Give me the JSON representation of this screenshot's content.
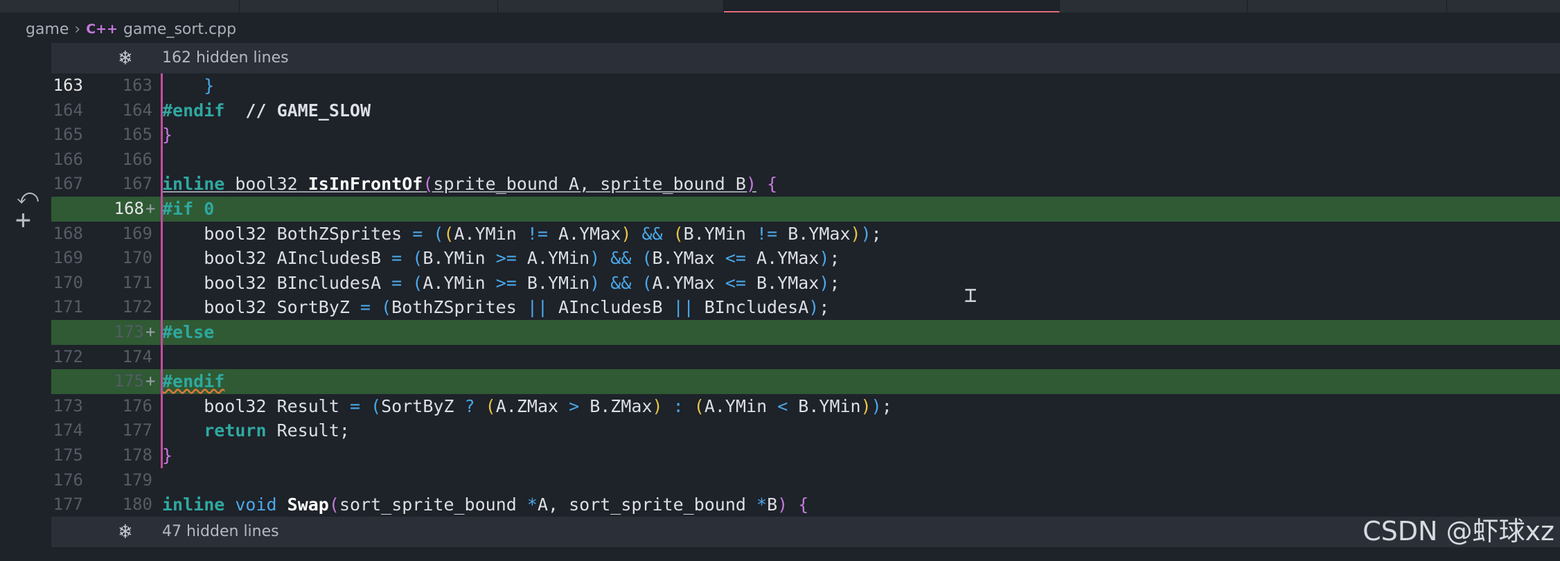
{
  "breadcrumb": {
    "folder": "game",
    "lang_badge": "C++",
    "file": "game_sort.cpp"
  },
  "folds": {
    "top": {
      "label": "162 hidden lines"
    },
    "bottom": {
      "label": "47 hidden lines"
    }
  },
  "lines": [
    {
      "old": "163",
      "new": "163",
      "current": true,
      "added": false,
      "html": "    <span class=\"p3\">}</span>"
    },
    {
      "old": "164",
      "new": "164",
      "current": false,
      "added": false,
      "html": "<span class=\"pp\">#endif</span>  <span class=\"cm\">// GAME_SLOW</span>"
    },
    {
      "old": "165",
      "new": "165",
      "current": false,
      "added": false,
      "html": "<span class=\"p2\">}</span>"
    },
    {
      "old": "166",
      "new": "166",
      "current": false,
      "added": false,
      "html": ""
    },
    {
      "old": "167",
      "new": "167",
      "current": false,
      "added": false,
      "html": "<span class=\"ul\"><span class=\"kw\">inline</span> <span class=\"ty\">bool32</span> <span class=\"fn\">IsInFrontOf</span><span class=\"p2\">(</span>sprite_bound A, sprite_bound B<span class=\"p2\">)</span></span> <span class=\"p2\">{</span>"
    },
    {
      "old": "",
      "new": "168",
      "current": true,
      "added": true,
      "html": "<span class=\"pp\">#if</span> <span class=\"nm\">0</span>"
    },
    {
      "old": "168",
      "new": "169",
      "current": false,
      "added": false,
      "html": "    bool32 BothZSprites <span class=\"op\">=</span> <span class=\"p3\">(</span><span class=\"p1\">(</span>A.YMin <span class=\"op\">!=</span> A.YMax<span class=\"p1\">)</span> <span class=\"op\">&amp;&amp;</span> <span class=\"p1\">(</span>B.YMin <span class=\"op\">!=</span> B.YMax<span class=\"p1\">)</span><span class=\"p3\">)</span>;"
    },
    {
      "old": "169",
      "new": "170",
      "current": false,
      "added": false,
      "html": "    bool32 AIncludesB <span class=\"op\">=</span> <span class=\"p3\">(</span>B.YMin <span class=\"op\">&gt;=</span> A.YMin<span class=\"p3\">)</span> <span class=\"op\">&amp;&amp;</span> <span class=\"p3\">(</span>B.YMax <span class=\"op\">&lt;=</span> A.YMax<span class=\"p3\">)</span>;"
    },
    {
      "old": "170",
      "new": "171",
      "current": false,
      "added": false,
      "html": "    bool32 BIncludesA <span class=\"op\">=</span> <span class=\"p3\">(</span>A.YMin <span class=\"op\">&gt;=</span> B.YMin<span class=\"p3\">)</span> <span class=\"op\">&amp;&amp;</span> <span class=\"p3\">(</span>A.YMax <span class=\"op\">&lt;=</span> B.YMax<span class=\"p3\">)</span>;"
    },
    {
      "old": "171",
      "new": "172",
      "current": false,
      "added": false,
      "html": "    bool32 SortByZ <span class=\"op\">=</span> <span class=\"p3\">(</span>BothZSprites <span class=\"op\">||</span> AIncludesB <span class=\"op\">||</span> BIncludesA<span class=\"p3\">)</span>;"
    },
    {
      "old": "",
      "new": "173",
      "current": false,
      "added": true,
      "html": "<span class=\"pp\">#else</span>"
    },
    {
      "old": "172",
      "new": "174",
      "current": false,
      "added": false,
      "html": ""
    },
    {
      "old": "",
      "new": "175",
      "current": false,
      "added": true,
      "html": "<span class=\"pp wavy\">#endif</span>"
    },
    {
      "old": "173",
      "new": "176",
      "current": false,
      "added": false,
      "html": "    bool32 Result <span class=\"op\">=</span> <span class=\"p3\">(</span>SortByZ <span class=\"op\">?</span> <span class=\"p1\">(</span>A.ZMax <span class=\"op\">&gt;</span> B.ZMax<span class=\"p1\">)</span> <span class=\"op\">:</span> <span class=\"p1\">(</span>A.YMin <span class=\"op\">&lt;</span> B.YMin<span class=\"p1\">)</span><span class=\"p3\">)</span>;"
    },
    {
      "old": "174",
      "new": "177",
      "current": false,
      "added": false,
      "html": "    <span class=\"kw\">return</span> Result;"
    },
    {
      "old": "175",
      "new": "178",
      "current": false,
      "added": false,
      "html": "<span class=\"p2\">}</span>"
    },
    {
      "old": "176",
      "new": "179",
      "current": false,
      "added": false,
      "html": ""
    },
    {
      "old": "177",
      "new": "180",
      "current": false,
      "added": false,
      "html": "<span class=\"kw\">inline</span> <span class=\"vd\">void</span> <span class=\"fn\">Swap</span><span class=\"p2\">(</span>sort_sprite_bound <span class=\"op\">*</span>A, sort_sprite_bound <span class=\"op\">*</span>B<span class=\"p2\">)</span> <span class=\"p2\">{</span>"
    }
  ],
  "watermark": "CSDN @虾球xz",
  "colors": {
    "added_line_bg": "#2f5a34",
    "gutter_bar": "#c24f9c",
    "keyword": "#2fa8a0",
    "operator": "#4aa8e8"
  }
}
